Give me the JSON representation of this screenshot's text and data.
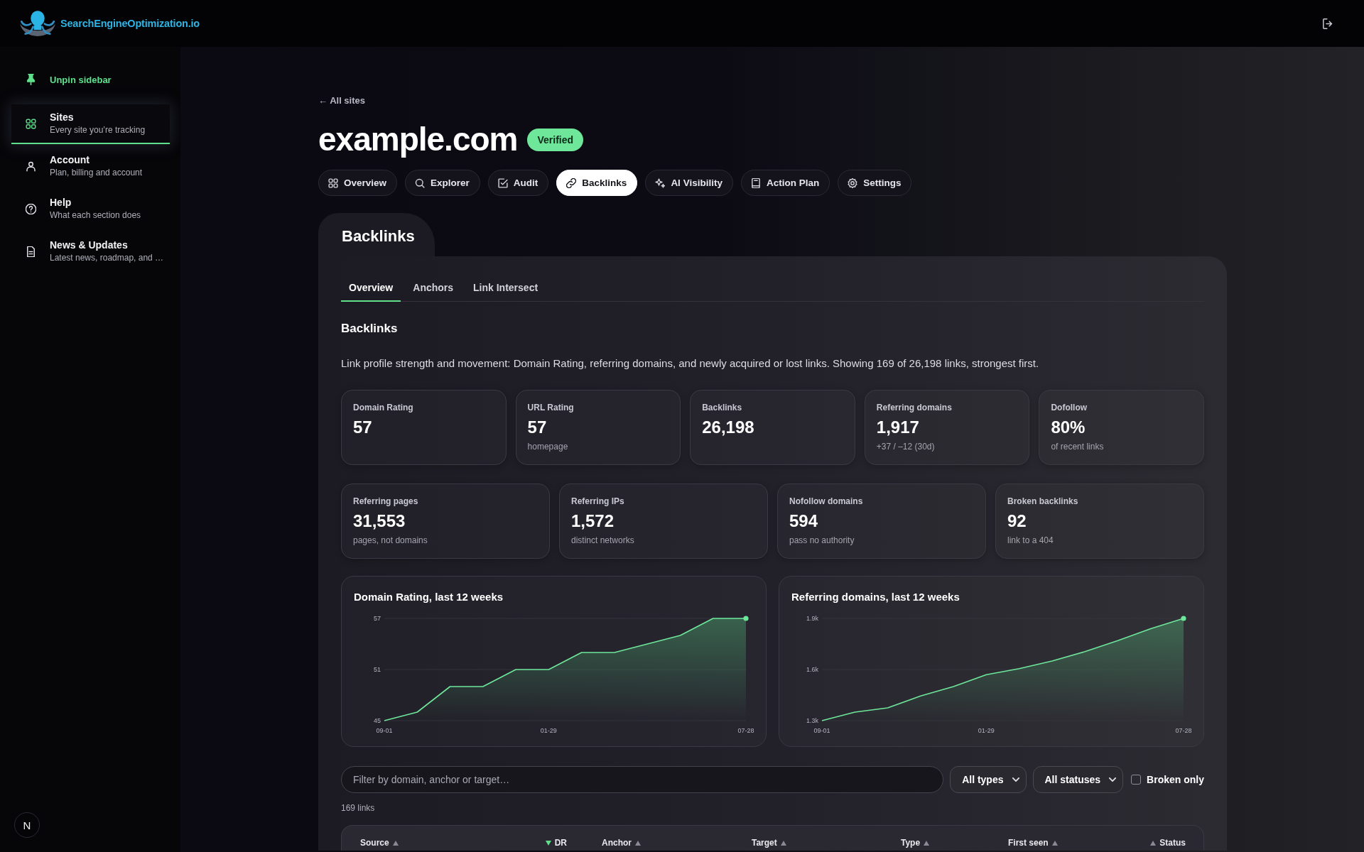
{
  "header": {
    "brand": "SearchEngineOptimization.io"
  },
  "sidebar": {
    "pin_toggle": "Unpin sidebar",
    "items": [
      {
        "label": "Sites",
        "description": "Every site you’re tracking",
        "selected": true
      },
      {
        "label": "Account",
        "description": "Plan, billing and account",
        "selected": false
      },
      {
        "label": "Help",
        "description": "What each section does",
        "selected": false
      },
      {
        "label": "News & Updates",
        "description": "Latest news, roadmap, and …",
        "selected": false
      }
    ],
    "corner_button": "N"
  },
  "breadcrumb": "← All sites",
  "site": {
    "domain": "example.com",
    "badge": "Verified"
  },
  "tabs": [
    {
      "label": "Overview",
      "selected": false
    },
    {
      "label": "Explorer",
      "selected": false
    },
    {
      "label": "Audit",
      "selected": false
    },
    {
      "label": "Backlinks",
      "selected": true
    },
    {
      "label": "AI Visibility",
      "selected": false
    },
    {
      "label": "Action Plan",
      "selected": false
    },
    {
      "label": "Settings",
      "selected": false
    }
  ],
  "panel": {
    "title": "Backlinks",
    "subtabs": [
      {
        "label": "Overview",
        "selected": true
      },
      {
        "label": "Anchors",
        "selected": false
      },
      {
        "label": "Link Intersect",
        "selected": false
      }
    ],
    "heading": "Backlinks",
    "description": "Link profile strength and movement: Domain Rating, referring domains, and newly acquired or lost links. Showing 169 of 26,198 links, strongest first.",
    "stat_rows": [
      [
        {
          "label": "Domain Rating",
          "value": "57"
        },
        {
          "label": "URL Rating",
          "value": "57",
          "note": "homepage"
        },
        {
          "label": "Backlinks",
          "value": "26,198"
        },
        {
          "label": "Referring domains",
          "value": "1,917",
          "note": "+37 / –12 (30d)"
        },
        {
          "label": "Dofollow",
          "value": "80%",
          "note": "of recent links"
        }
      ],
      [
        {
          "label": "Referring pages",
          "value": "31,553",
          "note": "pages, not domains"
        },
        {
          "label": "Referring IPs",
          "value": "1,572",
          "note": "distinct networks"
        },
        {
          "label": "Nofollow domains",
          "value": "594",
          "note": "pass no authority"
        },
        {
          "label": "Broken backlinks",
          "value": "92",
          "note": "link to a 404"
        }
      ]
    ],
    "charts": [
      {
        "chart_data": {
          "type": "area",
          "title": "Domain Rating, last 12 weeks",
          "categories": [
            "09-01",
            null,
            null,
            null,
            null,
            "01-29",
            null,
            null,
            null,
            null,
            null,
            "07-28"
          ],
          "values": [
            45,
            46,
            49,
            49,
            51,
            51,
            53,
            53,
            54,
            55,
            57,
            57
          ],
          "ylim": [
            45,
            57
          ],
          "yticks": [
            45,
            51,
            57
          ]
        }
      },
      {
        "chart_data": {
          "type": "area",
          "title": "Referring domains, last 12 weeks",
          "categories": [
            "09-01",
            null,
            null,
            null,
            null,
            "01-29",
            null,
            null,
            null,
            null,
            null,
            "07-28"
          ],
          "values": [
            1300,
            1350,
            1375,
            1445,
            1500,
            1570,
            1605,
            1650,
            1705,
            1770,
            1840,
            1900
          ],
          "ylim": [
            1300,
            1900
          ],
          "yticks": [
            {
              "value": 1300,
              "label": "1.3k"
            },
            {
              "value": 1600,
              "label": "1.6k"
            },
            {
              "value": 1900,
              "label": "1.9k"
            }
          ]
        }
      }
    ],
    "filters": {
      "search": {
        "placeholder": "Filter by domain, anchor or target…"
      },
      "selects": [
        "All types",
        "All statuses"
      ],
      "checkbox": {
        "label": "Broken only",
        "checked": false
      }
    },
    "count": "169 links",
    "table": {
      "columns": [
        {
          "label": "Source",
          "kind": "text",
          "sorted": false
        },
        {
          "label": "DR",
          "kind": "numeric",
          "sorted": true
        },
        {
          "label": "Anchor",
          "kind": "text",
          "sorted": false
        },
        {
          "label": "Target",
          "kind": "text",
          "sorted": false
        },
        {
          "label": "Type",
          "kind": "text",
          "sorted": false
        },
        {
          "label": "First seen",
          "kind": "text",
          "sorted": false
        },
        {
          "label": "Status",
          "kind": "status",
          "sorted": false
        }
      ]
    }
  }
}
